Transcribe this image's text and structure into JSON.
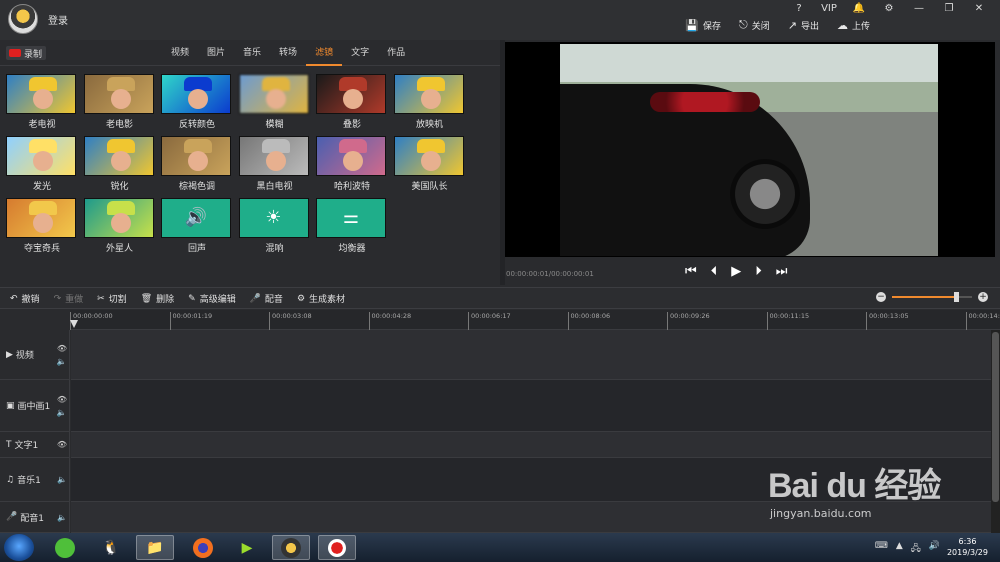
{
  "titlebar": {
    "login": "登录",
    "sys_icons": [
      "?",
      "VIP",
      "🔔",
      "⚙",
      "—",
      "❐",
      "✕"
    ]
  },
  "actions": [
    {
      "label": "保存",
      "icon": "save-icon",
      "glyph": "💾"
    },
    {
      "label": "关闭",
      "icon": "close-file-icon",
      "glyph": "⎋"
    },
    {
      "label": "导出",
      "icon": "export-icon",
      "glyph": "↗"
    },
    {
      "label": "上传",
      "icon": "upload-icon",
      "glyph": "☁"
    }
  ],
  "record_label": "录制",
  "tabs": [
    "视频",
    "图片",
    "音乐",
    "转场",
    "滤镜",
    "文字",
    "作品"
  ],
  "active_tab": "滤镜",
  "filters": [
    {
      "label": "老电视",
      "style": "normal"
    },
    {
      "label": "老电影",
      "style": "sepia"
    },
    {
      "label": "反转颜色",
      "style": "invert"
    },
    {
      "label": "模糊",
      "style": "blur"
    },
    {
      "label": "叠影",
      "style": "dark"
    },
    {
      "label": "放映机",
      "style": "normal"
    },
    {
      "label": "发光",
      "style": "glow"
    },
    {
      "label": "锐化",
      "style": "normal"
    },
    {
      "label": "棕褐色调",
      "style": "sepia"
    },
    {
      "label": "黑白电视",
      "style": "gray"
    },
    {
      "label": "哈利波特",
      "style": "cool"
    },
    {
      "label": "美国队长",
      "style": "normal"
    },
    {
      "label": "夺宝奇兵",
      "style": "warm"
    },
    {
      "label": "外星人",
      "style": "alien"
    },
    {
      "label": "回声",
      "style": "green",
      "glyph": "🔊"
    },
    {
      "label": "混响",
      "style": "green",
      "glyph": "☀"
    },
    {
      "label": "均衡器",
      "style": "green",
      "glyph": "⚌"
    }
  ],
  "player": {
    "timecode": "00:00:00:01/00:00:00:01",
    "controls": [
      "⏮",
      "⏴",
      "▶",
      "⏵",
      "⏭"
    ]
  },
  "toolbar": [
    {
      "label": "撤销",
      "glyph": "↶",
      "icon": "undo-icon",
      "enabled": true
    },
    {
      "label": "重做",
      "glyph": "↷",
      "icon": "redo-icon",
      "enabled": false
    },
    {
      "label": "切割",
      "glyph": "✂",
      "icon": "cut-icon",
      "enabled": true
    },
    {
      "label": "删除",
      "glyph": "🗑",
      "icon": "delete-icon",
      "enabled": true
    },
    {
      "label": "高级编辑",
      "glyph": "✎",
      "icon": "edit-icon",
      "enabled": true
    },
    {
      "label": "配音",
      "glyph": "🎤",
      "icon": "mic-icon",
      "enabled": true
    },
    {
      "label": "生成素材",
      "glyph": "⚙",
      "icon": "generate-icon",
      "enabled": true
    }
  ],
  "zoom_level": 0.8,
  "ruler_ticks": [
    "00:00:00:00",
    "00:00:01:19",
    "00:00:03:08",
    "00:00:04:28",
    "00:00:06:17",
    "00:00:08:06",
    "00:00:09:26",
    "00:00:11:15",
    "00:00:13:05",
    "00:00:14:"
  ],
  "tracks": [
    {
      "label": "视频",
      "glyph": "▶",
      "icon": "video-track-icon",
      "side": [
        "👁",
        "🔈"
      ]
    },
    {
      "label": "画中画1",
      "glyph": "▣",
      "icon": "pip-track-icon",
      "side": [
        "👁",
        "🔈"
      ]
    },
    {
      "label": "文字1",
      "glyph": "T",
      "icon": "text-track-icon",
      "side": [
        "👁"
      ]
    },
    {
      "label": "音乐1",
      "glyph": "♫",
      "icon": "music-track-icon",
      "side": [
        "🔈"
      ]
    },
    {
      "label": "配音1",
      "glyph": "🎤",
      "icon": "voice-track-icon",
      "side": [
        "🔈"
      ]
    }
  ],
  "taskbar": {
    "time": "6:36",
    "date": "2019/3/29"
  },
  "watermark": {
    "brand": "Bai du 经验",
    "url": "jingyan.baidu.com"
  }
}
